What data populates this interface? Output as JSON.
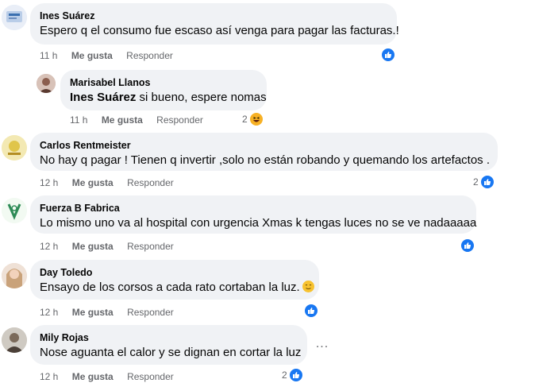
{
  "comments": [
    {
      "author": "Ines Suárez",
      "text": "Espero q el consumo fue escaso así venga para pagar las facturas.!",
      "time": "11 h",
      "like_label": "Me gusta",
      "reply_label": "Responder",
      "reactions": {
        "icons": [
          "like-icon"
        ],
        "count": ""
      }
    },
    {
      "author": "Marisabel Llanos",
      "mention": "Ines Suárez",
      "text": " si bueno, espere nomas",
      "time": "11 h",
      "like_label": "Me gusta",
      "reply_label": "Responder",
      "reactions": {
        "icons": [
          "haha-icon"
        ],
        "count": "2"
      }
    },
    {
      "author": "Carlos Rentmeister",
      "text": "No hay q pagar ! Tienen q invertir ,solo no están robando y quemando los artefactos .",
      "time": "12 h",
      "like_label": "Me gusta",
      "reply_label": "Responder",
      "reactions": {
        "icons": [
          "like-icon"
        ],
        "count": "2"
      }
    },
    {
      "author": "Fuerza B Fabrica",
      "text": "Lo mismo uno va al hospital con urgencia Xmas k tengas luces no se ve nadaaaaa",
      "time": "12 h",
      "like_label": "Me gusta",
      "reply_label": "Responder",
      "reactions": {
        "icons": [
          "like-icon"
        ],
        "count": ""
      }
    },
    {
      "author": "Day Toledo",
      "text": "Ensayo de los corsos a cada rato cortaban la luz.",
      "emoji": "smiling-face-emoji",
      "time": "12 h",
      "like_label": "Me gusta",
      "reply_label": "Responder",
      "reactions": {
        "icons": [
          "like-icon"
        ],
        "count": ""
      }
    },
    {
      "author": "Mily Rojas",
      "text": "Nose aguanta el calor y se dignan en cortar la luz",
      "time": "12 h",
      "like_label": "Me gusta",
      "reply_label": "Responder",
      "reactions": {
        "icons": [
          "like-icon"
        ],
        "count": "2"
      },
      "more_label": "..."
    }
  ],
  "colors": {
    "bubble": "#f0f2f5",
    "like": "#1877f2",
    "meta": "#65676b",
    "haha": "#f7b125"
  }
}
